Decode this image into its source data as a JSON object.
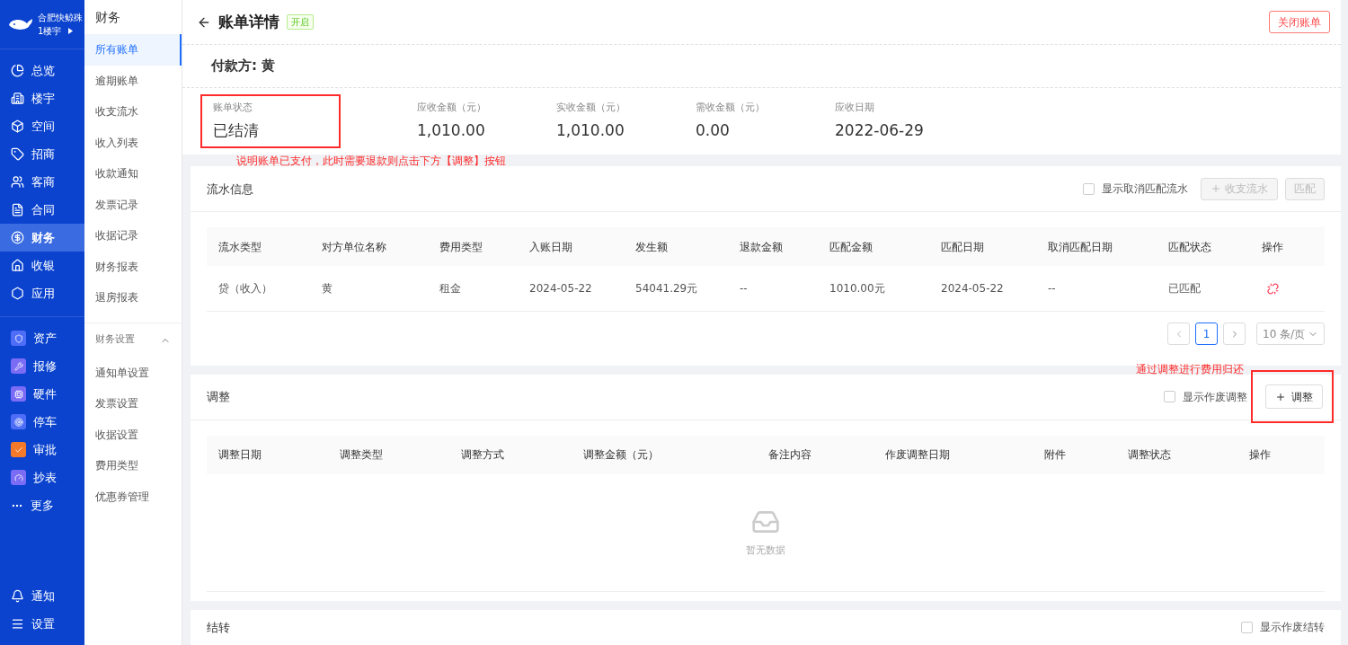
{
  "brand": {
    "company": "合肥快鲸殊",
    "building": "1楼宇"
  },
  "main_nav": [
    {
      "label": "总览",
      "selected": false
    },
    {
      "label": "楼宇",
      "selected": false
    },
    {
      "label": "空间",
      "selected": false
    },
    {
      "label": "招商",
      "selected": false
    },
    {
      "label": "客商",
      "selected": false
    },
    {
      "label": "合同",
      "selected": false
    },
    {
      "label": "财务",
      "selected": true
    },
    {
      "label": "收银",
      "selected": false
    },
    {
      "label": "应用",
      "selected": false
    }
  ],
  "app_nav": [
    {
      "kind": "tile",
      "label": "资产",
      "color": "#4f6ef7"
    },
    {
      "kind": "tile",
      "label": "报修",
      "color": "#7b6cf6"
    },
    {
      "kind": "tile",
      "label": "硬件",
      "color": "#7b6cf6"
    },
    {
      "kind": "tile",
      "label": "停车",
      "color": "#4f6ef7"
    },
    {
      "kind": "tile",
      "label": "审批",
      "color": "#f5792a"
    },
    {
      "kind": "tile",
      "label": "抄表",
      "color": "#7b6cf6"
    },
    {
      "kind": "more",
      "label": "更多"
    }
  ],
  "bottom_nav": [
    {
      "label": "通知"
    },
    {
      "label": "设置"
    }
  ],
  "sub_nav": {
    "title": "财务",
    "items": [
      {
        "label": "所有账单",
        "selected": true
      },
      {
        "label": "逾期账单",
        "selected": false
      },
      {
        "label": "收支流水",
        "selected": false
      },
      {
        "label": "收入列表",
        "selected": false
      },
      {
        "label": "收款通知",
        "selected": false
      },
      {
        "label": "发票记录",
        "selected": false
      },
      {
        "label": "收据记录",
        "selected": false
      },
      {
        "label": "财务报表",
        "selected": false
      },
      {
        "label": "退房报表",
        "selected": false
      }
    ],
    "group": {
      "label": "财务设置",
      "expanded": true,
      "children": [
        {
          "label": "通知单设置",
          "selected": false
        },
        {
          "label": "发票设置",
          "selected": false
        },
        {
          "label": "收据设置",
          "selected": false
        },
        {
          "label": "费用类型",
          "selected": false
        },
        {
          "label": "优惠券管理",
          "selected": false
        }
      ]
    }
  },
  "header": {
    "title": "账单详情",
    "tag": "开启",
    "close_button": "关闭账单"
  },
  "payer": "付款方: 黄",
  "stats": [
    {
      "label": "账单状态",
      "value": "已结清",
      "highlighted": true
    },
    {
      "label": "应收金额（元）",
      "value": "1,010.00",
      "highlighted": false
    },
    {
      "label": "实收金额（元）",
      "value": "1,010.00",
      "highlighted": false
    },
    {
      "label": "需收金额（元）",
      "value": "0.00",
      "highlighted": false
    },
    {
      "label": "应收日期",
      "value": "2022-06-29",
      "highlighted": false
    }
  ],
  "stats_note": "说明账单已支付，此时需要退款则点击下方【调整】按钮",
  "flow": {
    "title": "流水信息",
    "checkbox": {
      "label": "显示取消匹配流水",
      "checked": false
    },
    "add_button": {
      "label": "收支流水",
      "disabled": true
    },
    "match_button": {
      "label": "匹配",
      "disabled": true
    },
    "columns": [
      "流水类型",
      "对方单位名称",
      "费用类型",
      "入账日期",
      "发生额",
      "退款金额",
      "匹配金额",
      "匹配日期",
      "取消匹配日期",
      "匹配状态",
      "操作"
    ],
    "rows": [
      {
        "cells": [
          "贷（收入）",
          "黄",
          "租金",
          "2024-05-22",
          "54041.29元",
          "--",
          "1010.00元",
          "2024-05-22",
          "--",
          "已匹配"
        ]
      }
    ],
    "pagination": {
      "pages": [
        {
          "label": "1",
          "selected": true
        }
      ],
      "page_size": "10 条/页"
    }
  },
  "adjust": {
    "note": "通过调整进行费用归还",
    "title": "调整",
    "checkbox": {
      "label": "显示作废调整",
      "checked": false
    },
    "button": {
      "label": "调整",
      "highlighted": true
    },
    "columns": [
      "调整日期",
      "调整类型",
      "调整方式",
      "调整金额（元）",
      "备注内容",
      "作废调整日期",
      "附件",
      "调整状态",
      "操作"
    ],
    "empty": "暂无数据"
  },
  "carry": {
    "title": "结转",
    "checkbox": {
      "label": "显示作废结转",
      "checked": false
    }
  }
}
